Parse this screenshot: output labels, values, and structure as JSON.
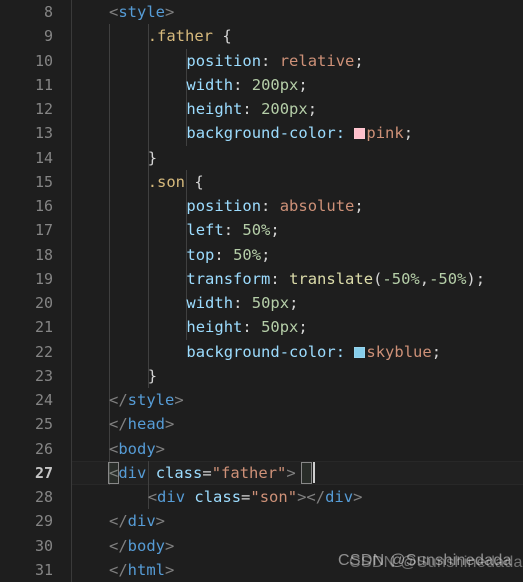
{
  "editor": {
    "theme": "vscode-dark",
    "language": "html",
    "first_line_number": 8,
    "last_line_number": 31,
    "active_line_number": 27,
    "colors": {
      "background": "#1e1e1e",
      "line_number": "#858585",
      "line_number_active": "#c6c6c6",
      "tag": "#569cd6",
      "attribute": "#9cdcfe",
      "string": "#ce9178",
      "number": "#b5cea8",
      "selector": "#d7ba7d",
      "function": "#dcdcaa",
      "punctuation": "#d4d4d4",
      "swatch_pink": "#ffc0cb",
      "swatch_skyblue": "#87ceeb"
    }
  },
  "line_numbers": [
    8,
    9,
    10,
    11,
    12,
    13,
    14,
    15,
    16,
    17,
    18,
    19,
    20,
    21,
    22,
    23,
    24,
    25,
    26,
    27,
    28,
    29,
    30,
    31
  ],
  "lines": [
    {
      "number": 8,
      "indent": 2,
      "text": "<style>"
    },
    {
      "number": 9,
      "indent": 3,
      "text": ".father {"
    },
    {
      "number": 10,
      "indent": 4,
      "text": "position: relative;"
    },
    {
      "number": 11,
      "indent": 4,
      "text": "width: 200px;"
    },
    {
      "number": 12,
      "indent": 4,
      "text": "height: 200px;"
    },
    {
      "number": 13,
      "indent": 4,
      "text": "background-color: pink;"
    },
    {
      "number": 14,
      "indent": 3,
      "text": "}"
    },
    {
      "number": 15,
      "indent": 3,
      "text": ".son {"
    },
    {
      "number": 16,
      "indent": 4,
      "text": "position: absolute;"
    },
    {
      "number": 17,
      "indent": 4,
      "text": "left: 50%;"
    },
    {
      "number": 18,
      "indent": 4,
      "text": "top: 50%;"
    },
    {
      "number": 19,
      "indent": 4,
      "text": "transform: translate(-50%,-50%);"
    },
    {
      "number": 20,
      "indent": 4,
      "text": "width: 50px;"
    },
    {
      "number": 21,
      "indent": 4,
      "text": "height: 50px;"
    },
    {
      "number": 22,
      "indent": 4,
      "text": "background-color: skyblue;"
    },
    {
      "number": 23,
      "indent": 3,
      "text": "}"
    },
    {
      "number": 24,
      "indent": 2,
      "text": "</style>"
    },
    {
      "number": 25,
      "indent": 1,
      "text": "</head>"
    },
    {
      "number": 26,
      "indent": 1,
      "text": "<body>"
    },
    {
      "number": 27,
      "indent": 2,
      "text": "<div class=\"father\">"
    },
    {
      "number": 28,
      "indent": 3,
      "text": "<div class=\"son\"></div>"
    },
    {
      "number": 29,
      "indent": 2,
      "text": "</div>"
    },
    {
      "number": 30,
      "indent": 1,
      "text": "</body>"
    },
    {
      "number": 31,
      "indent": 1,
      "text": "</html>"
    }
  ],
  "tokens": {
    "l8": [
      {
        "c": "t-punct",
        "t": "<"
      },
      {
        "c": "t-tag",
        "t": "style"
      },
      {
        "c": "t-punct",
        "t": ">"
      }
    ],
    "l9": [
      {
        "c": "t-sel",
        "t": ".father"
      },
      {
        "c": "t-plain",
        "t": " "
      },
      {
        "c": "t-brace",
        "t": "{"
      }
    ],
    "l10": [
      {
        "c": "t-prop",
        "t": "position"
      },
      {
        "c": "t-plain",
        "t": ": "
      },
      {
        "c": "t-val",
        "t": "relative"
      },
      {
        "c": "t-plain",
        "t": ";"
      }
    ],
    "l11": [
      {
        "c": "t-prop",
        "t": "width"
      },
      {
        "c": "t-plain",
        "t": ": "
      },
      {
        "c": "t-num",
        "t": "200px"
      },
      {
        "c": "t-plain",
        "t": ";"
      }
    ],
    "l12": [
      {
        "c": "t-prop",
        "t": "height"
      },
      {
        "c": "t-plain",
        "t": ": "
      },
      {
        "c": "t-num",
        "t": "200px"
      },
      {
        "c": "t-plain",
        "t": ";"
      }
    ],
    "l13pre": "background-color: ",
    "l13val": "pink",
    "l13end": ";",
    "l14": [
      {
        "c": "t-brace",
        "t": "}"
      }
    ],
    "l15": [
      {
        "c": "t-sel",
        "t": ".son"
      },
      {
        "c": "t-plain",
        "t": " "
      },
      {
        "c": "t-brace",
        "t": "{"
      }
    ],
    "l16": [
      {
        "c": "t-prop",
        "t": "position"
      },
      {
        "c": "t-plain",
        "t": ": "
      },
      {
        "c": "t-val",
        "t": "absolute"
      },
      {
        "c": "t-plain",
        "t": ";"
      }
    ],
    "l17": [
      {
        "c": "t-prop",
        "t": "left"
      },
      {
        "c": "t-plain",
        "t": ": "
      },
      {
        "c": "t-num",
        "t": "50%"
      },
      {
        "c": "t-plain",
        "t": ";"
      }
    ],
    "l18": [
      {
        "c": "t-prop",
        "t": "top"
      },
      {
        "c": "t-plain",
        "t": ": "
      },
      {
        "c": "t-num",
        "t": "50%"
      },
      {
        "c": "t-plain",
        "t": ";"
      }
    ],
    "l19": [
      {
        "c": "t-prop",
        "t": "transform"
      },
      {
        "c": "t-plain",
        "t": ": "
      },
      {
        "c": "t-fn",
        "t": "translate"
      },
      {
        "c": "t-plain",
        "t": "("
      },
      {
        "c": "t-num",
        "t": "-50%"
      },
      {
        "c": "t-plain",
        "t": ","
      },
      {
        "c": "t-num",
        "t": "-50%"
      },
      {
        "c": "t-plain",
        "t": ");"
      }
    ],
    "l20": [
      {
        "c": "t-prop",
        "t": "width"
      },
      {
        "c": "t-plain",
        "t": ": "
      },
      {
        "c": "t-num",
        "t": "50px"
      },
      {
        "c": "t-plain",
        "t": ";"
      }
    ],
    "l21": [
      {
        "c": "t-prop",
        "t": "height"
      },
      {
        "c": "t-plain",
        "t": ": "
      },
      {
        "c": "t-num",
        "t": "50px"
      },
      {
        "c": "t-plain",
        "t": ";"
      }
    ],
    "l22pre": "background-color: ",
    "l22val": "skyblue",
    "l22end": ";",
    "l23": [
      {
        "c": "t-brace",
        "t": "}"
      }
    ],
    "l24": [
      {
        "c": "t-punct",
        "t": "</"
      },
      {
        "c": "t-tag",
        "t": "style"
      },
      {
        "c": "t-punct",
        "t": ">"
      }
    ],
    "l25": [
      {
        "c": "t-punct",
        "t": "</"
      },
      {
        "c": "t-tag",
        "t": "head"
      },
      {
        "c": "t-punct",
        "t": ">"
      }
    ],
    "l26": [
      {
        "c": "t-punct",
        "t": "<"
      },
      {
        "c": "t-tag",
        "t": "body"
      },
      {
        "c": "t-punct",
        "t": ">"
      }
    ],
    "l27": [
      {
        "c": "t-punct",
        "t": "<"
      },
      {
        "c": "t-tag",
        "t": "div"
      },
      {
        "c": "t-plain",
        "t": " "
      },
      {
        "c": "t-attr",
        "t": "class"
      },
      {
        "c": "t-plain",
        "t": "="
      },
      {
        "c": "t-str",
        "t": "\"father\""
      },
      {
        "c": "t-punct",
        "t": ">"
      }
    ],
    "l28": [
      {
        "c": "t-punct",
        "t": "<"
      },
      {
        "c": "t-tag",
        "t": "div"
      },
      {
        "c": "t-plain",
        "t": " "
      },
      {
        "c": "t-attr",
        "t": "class"
      },
      {
        "c": "t-plain",
        "t": "="
      },
      {
        "c": "t-str",
        "t": "\"son\""
      },
      {
        "c": "t-punct",
        "t": ">"
      },
      {
        "c": "t-punct",
        "t": "</"
      },
      {
        "c": "t-tag",
        "t": "div"
      },
      {
        "c": "t-punct",
        "t": ">"
      }
    ],
    "l29": [
      {
        "c": "t-punct",
        "t": "</"
      },
      {
        "c": "t-tag",
        "t": "div"
      },
      {
        "c": "t-punct",
        "t": ">"
      }
    ],
    "l30": [
      {
        "c": "t-punct",
        "t": "</"
      },
      {
        "c": "t-tag",
        "t": "body"
      },
      {
        "c": "t-punct",
        "t": ">"
      }
    ],
    "l31": [
      {
        "c": "t-punct",
        "t": "</"
      },
      {
        "c": "t-tag",
        "t": "html"
      },
      {
        "c": "t-punct",
        "t": ">"
      }
    ]
  },
  "watermark": {
    "text": "CSDN @Sunshinedada"
  }
}
